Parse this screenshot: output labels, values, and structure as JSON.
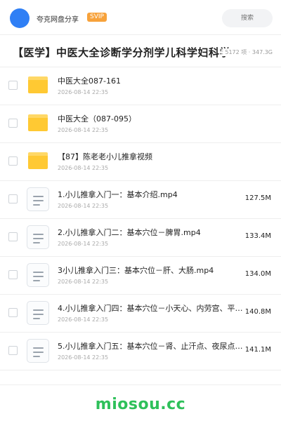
{
  "header": {
    "brand": "夸克网盘分享",
    "badge": "SVIP",
    "search_placeholder": "搜索"
  },
  "share": {
    "title": "【医学】中医大全诊断学分剂学儿科学妇科学",
    "meta": "5172 项 · 347.3G"
  },
  "items": [
    {
      "type": "folder",
      "name": "中医大全087-161",
      "date": "2026-08-14 22:35",
      "size": ""
    },
    {
      "type": "folder",
      "name": "中医大全（087-095）",
      "date": "2026-08-14 22:35",
      "size": ""
    },
    {
      "type": "folder",
      "name": "【87】陈老老小儿推拿视频",
      "date": "2026-08-14 22:35",
      "size": ""
    },
    {
      "type": "file",
      "name": "1.小儿推拿入门一：基本介绍.mp4",
      "date": "2026-08-14 22:35",
      "size": "127.5M"
    },
    {
      "type": "file",
      "name": "2.小儿推拿入门二：基本穴位－脾胃.mp4",
      "date": "2026-08-14 22:35",
      "size": "133.4M"
    },
    {
      "type": "file",
      "name": "3小儿推拿入门三：基本穴位－肝、大肠.mp4",
      "date": "2026-08-14 22:35",
      "size": "134.0M"
    },
    {
      "type": "file",
      "name": "4.小儿推拿入门四：基本穴位－小天心、内劳宫、平肝…",
      "date": "2026-08-14 22:35",
      "size": "140.8M"
    },
    {
      "type": "file",
      "name": "5.小儿推拿入门五：基本穴位－肾、止汗点、夜尿点、…",
      "date": "2026-08-14 22:35",
      "size": "141.1M"
    }
  ],
  "watermark": "miosou.cc",
  "colors": {
    "accent": "#2f7ff5",
    "svip": "#f7a23b",
    "folder": "#ffc933",
    "watermark": "#2ec05a"
  }
}
